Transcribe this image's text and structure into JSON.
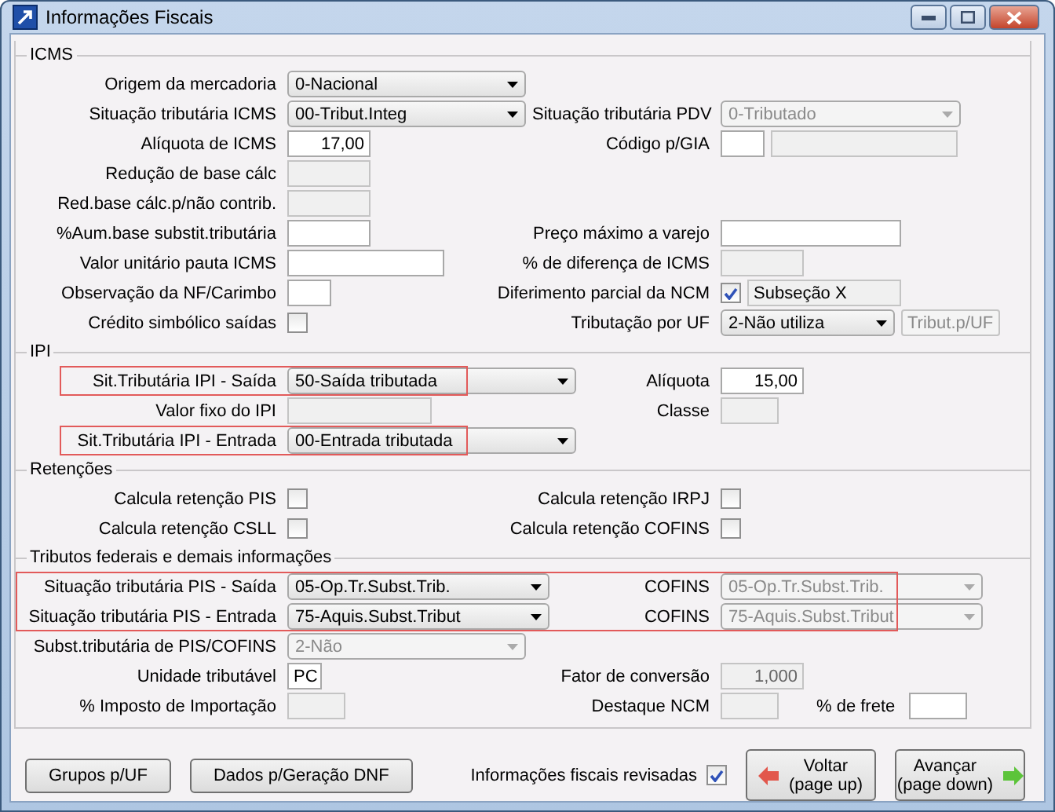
{
  "window": {
    "title": "Informações Fiscais"
  },
  "sections": [
    {
      "title": "ICMS",
      "rows": [
        {
          "left": {
            "label": "Origem da mercadoria",
            "kind": "combo",
            "value": "0-Nacional",
            "disabled": false
          },
          "right": []
        },
        {
          "left": {
            "label": "Situação tributária ICMS",
            "kind": "combo",
            "value": "00-Tribut.Integ",
            "disabled": false
          },
          "right": [
            {
              "label": "Situação tributária PDV",
              "kind": "combo",
              "value": "0-Tributado",
              "disabled": true
            }
          ]
        },
        {
          "left": {
            "label": "Alíquota de ICMS",
            "kind": "number",
            "value": "17,00",
            "disabled": false
          },
          "right": [
            {
              "label": "Código p/GIA",
              "kind": "input_pair",
              "disabled": false
            }
          ]
        },
        {
          "left": {
            "label": "Redução de base cálc",
            "kind": "input",
            "disabled": true
          },
          "right": []
        },
        {
          "left": {
            "label": "Red.base cálc.p/não contrib.",
            "kind": "input",
            "disabled": true
          },
          "right": []
        },
        {
          "left": {
            "label": "%Aum.base substit.tributária",
            "kind": "input",
            "disabled": false
          },
          "right": [
            {
              "label": "Preço máximo a varejo",
              "kind": "input",
              "disabled": false
            }
          ]
        },
        {
          "left": {
            "label": "Valor unitário pauta ICMS",
            "kind": "input",
            "disabled": false
          },
          "right": [
            {
              "label": "% de diferença de ICMS",
              "kind": "input",
              "disabled": true
            }
          ]
        },
        {
          "left": {
            "label": "Observação da NF/Carimbo",
            "kind": "input",
            "disabled": false
          },
          "right": [
            {
              "label": "Diferimento parcial da NCM",
              "kind": "check_text",
              "checked": true,
              "value": "Subseção X"
            }
          ]
        },
        {
          "left": {
            "label": "Crédito simbólico saídas",
            "kind": "checkbox",
            "checked": false
          },
          "right": [
            {
              "label": "Tributação por UF",
              "kind": "combo_button",
              "value": "2-Não utiliza",
              "disabled": false,
              "button": "Tribut.p/UF"
            }
          ]
        }
      ]
    },
    {
      "title": "IPI",
      "rows": [
        {
          "highlighted": true,
          "left": {
            "label": "Sit.Tributária IPI - Saída",
            "kind": "combo",
            "value": "50-Saída tributada",
            "disabled": false
          },
          "right": [
            {
              "label": "Alíquota",
              "kind": "number",
              "value": "15,00",
              "disabled": false
            }
          ]
        },
        {
          "left": {
            "label": "Valor fixo do IPI",
            "kind": "input",
            "disabled": true
          },
          "right": [
            {
              "label": "Classe",
              "kind": "input",
              "disabled": true
            }
          ]
        },
        {
          "highlighted": true,
          "left": {
            "label": "Sit.Tributária IPI - Entrada",
            "kind": "combo",
            "value": "00-Entrada tributada",
            "disabled": false
          },
          "right": []
        }
      ]
    },
    {
      "title": "Retenções",
      "rows": [
        {
          "left": {
            "label": "Calcula retenção PIS",
            "kind": "checkbox",
            "checked": false
          },
          "right": [
            {
              "label": "Calcula retenção IRPJ",
              "kind": "checkbox",
              "checked": false
            }
          ]
        },
        {
          "left": {
            "label": "Calcula retenção CSLL",
            "kind": "checkbox",
            "checked": false
          },
          "right": [
            {
              "label": "Calcula retenção COFINS",
              "kind": "checkbox",
              "checked": false
            }
          ]
        }
      ]
    },
    {
      "title": "Tributos federais e demais informações",
      "rows": [
        {
          "highlighted": true,
          "left": {
            "label": "Situação tributária PIS - Saída",
            "kind": "combo",
            "value": "05-Op.Tr.Subst.Trib.",
            "disabled": false
          },
          "right": [
            {
              "label": "COFINS",
              "kind": "combo",
              "value": "05-Op.Tr.Subst.Trib.",
              "disabled": true
            }
          ]
        },
        {
          "highlighted": true,
          "left": {
            "label": "Situação tributária PIS - Entrada",
            "kind": "combo",
            "value": "75-Aquis.Subst.Tribut",
            "disabled": false
          },
          "right": [
            {
              "label": "COFINS",
              "kind": "combo",
              "value": "75-Aquis.Subst.Tribut",
              "disabled": true
            }
          ]
        },
        {
          "left": {
            "label": "Subst.tributária de PIS/COFINS",
            "kind": "combo",
            "value": "2-Não",
            "disabled": true
          },
          "right": []
        },
        {
          "left": {
            "label": "Unidade tributável",
            "kind": "input",
            "value": "PC",
            "disabled": false
          },
          "right": [
            {
              "label": "Fator de conversão",
              "kind": "number",
              "value": "1,000",
              "disabled": true
            }
          ]
        },
        {
          "left": {
            "label": "% Imposto de Importação",
            "kind": "input",
            "disabled": true
          },
          "right": [
            {
              "label": "Destaque NCM",
              "kind": "input",
              "disabled": true
            },
            {
              "label": "% de frete",
              "kind": "input",
              "disabled": false
            }
          ]
        }
      ]
    }
  ],
  "footer": {
    "buttons": [
      "Grupos p/UF",
      "Dados p/Geração DNF"
    ],
    "reviewed": {
      "label": "Informações fiscais revisadas",
      "checked": true
    },
    "nav": [
      {
        "kind": "back",
        "label": "Voltar",
        "sublabel": "(page up)"
      },
      {
        "kind": "forward",
        "label": "Avançar",
        "sublabel": "(page down)"
      }
    ]
  }
}
